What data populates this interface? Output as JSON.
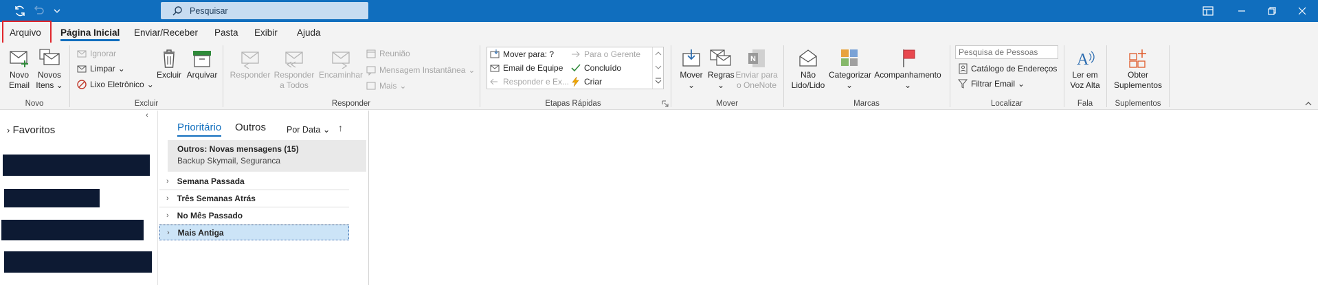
{
  "search": {
    "placeholder": "Pesquisar"
  },
  "menu": {
    "tabs": [
      "Arquivo",
      "Página Inicial",
      "Enviar/Receber",
      "Pasta",
      "Exibir",
      "Ajuda"
    ]
  },
  "ribbon": {
    "novo": {
      "novo_email": [
        "Novo",
        "Email"
      ],
      "novos_itens": [
        "Novos",
        "Itens"
      ],
      "group": "Novo"
    },
    "excluir": {
      "ignorar": "Ignorar",
      "limpar": "Limpar",
      "lixo": "Lixo Eletrônico",
      "excluir": "Excluir",
      "arquivar": "Arquivar",
      "group": "Excluir"
    },
    "responder": {
      "responder": "Responder",
      "responder_todos": [
        "Responder",
        "a Todos"
      ],
      "encaminhar": "Encaminhar",
      "reuniao": "Reunião",
      "mensagem_instantanea": "Mensagem Instantânea",
      "mais": "Mais",
      "group": "Responder"
    },
    "etapas": {
      "mover_para": "Mover para: ?",
      "email_equipe": "Email de Equipe",
      "responder_ex": "Responder e Ex...",
      "para_gerente": "Para o Gerente",
      "concluido": "Concluído",
      "criar": "Criar",
      "group": "Etapas Rápidas"
    },
    "mover": {
      "mover": "Mover",
      "regras": "Regras",
      "onenote": [
        "Enviar para",
        "o OneNote"
      ],
      "group": "Mover"
    },
    "marcas": {
      "nao_lido": [
        "Não",
        "Lido/Lido"
      ],
      "categorizar": "Categorizar",
      "acompanhamento": "Acompanhamento",
      "group": "Marcas"
    },
    "localizar": {
      "pesquisa_pessoas": "Pesquisa de Pessoas",
      "catalogo": "Catálogo de Endereços",
      "filtrar": "Filtrar Email",
      "group": "Localizar"
    },
    "fala": {
      "ler": [
        "Ler em",
        "Voz Alta"
      ],
      "group": "Fala"
    },
    "suplementos": {
      "obter": [
        "Obter",
        "Suplementos"
      ],
      "group": "Suplementos"
    }
  },
  "folders": {
    "favoritos": "Favoritos"
  },
  "list": {
    "tabs": [
      "Prioritário",
      "Outros"
    ],
    "sort_label": "Por Data",
    "notice_title": "Outros: Novas mensagens (15)",
    "notice_body": "Backup Skymail, Seguranca",
    "groups": [
      "Semana Passada",
      "Três Semanas Atrás",
      "No Mês Passado",
      "Mais Antiga"
    ]
  },
  "colors": {
    "accent": "#106ebe",
    "titlebar": "#106ebe",
    "highlight": "#e0242a",
    "redaction": "#0d1a33",
    "selected_row": "#cce4f7"
  }
}
